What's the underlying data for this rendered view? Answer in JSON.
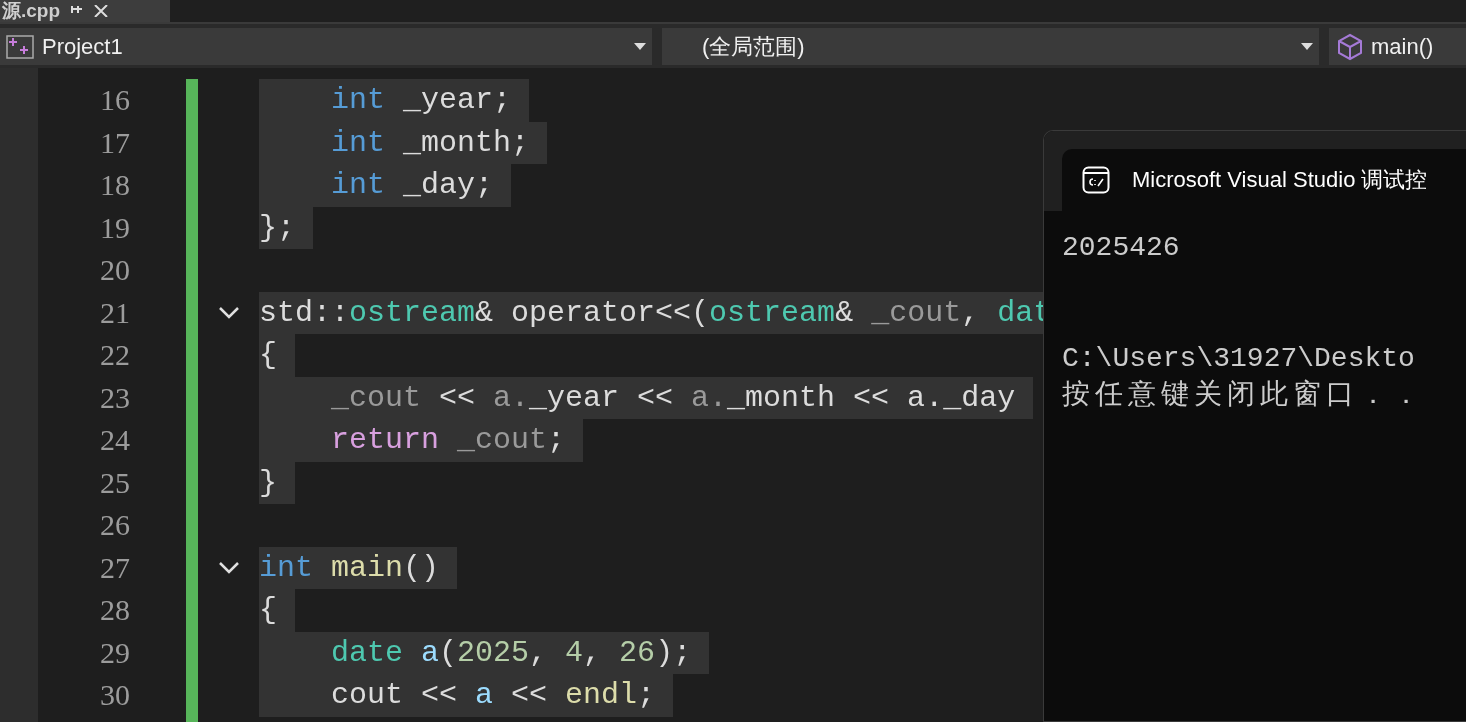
{
  "document_tab": {
    "title": "源.cpp"
  },
  "navigation_bar": {
    "project": "Project1",
    "scope": "(全局范围)",
    "member": "main()"
  },
  "editor": {
    "lines": [
      {
        "number": "16",
        "indented": true,
        "tokens": [
          {
            "kind": "keyword",
            "text": "int"
          },
          {
            "kind": "plain",
            "text": " _year;"
          }
        ]
      },
      {
        "number": "17",
        "indented": true,
        "tokens": [
          {
            "kind": "keyword",
            "text": "int"
          },
          {
            "kind": "plain",
            "text": " _month;"
          }
        ]
      },
      {
        "number": "18",
        "indented": true,
        "tokens": [
          {
            "kind": "keyword",
            "text": "int"
          },
          {
            "kind": "plain",
            "text": " _day;"
          }
        ]
      },
      {
        "number": "19",
        "indented": false,
        "tokens": [
          {
            "kind": "plain",
            "text": "};"
          }
        ]
      },
      {
        "number": "20",
        "indented": false
      },
      {
        "number": "21",
        "indented": false,
        "kind": "fold",
        "tokens": [
          {
            "kind": "plain",
            "text": "std::"
          },
          {
            "kind": "type",
            "text": "ostream"
          },
          {
            "kind": "plain",
            "text": "& operator<<("
          },
          {
            "kind": "type",
            "text": "ostream"
          },
          {
            "kind": "plain",
            "text": "& "
          },
          {
            "kind": "param",
            "text": "_cout"
          },
          {
            "kind": "plain",
            "text": ", "
          },
          {
            "kind": "type",
            "text": "dat"
          }
        ]
      },
      {
        "number": "22",
        "indented": false,
        "tokens": [
          {
            "kind": "plain",
            "text": "{"
          }
        ]
      },
      {
        "number": "23",
        "indented": true,
        "tokens": [
          {
            "kind": "param",
            "text": "_cout"
          },
          {
            "kind": "plain",
            "text": " << "
          },
          {
            "kind": "param",
            "text": "a."
          },
          {
            "kind": "plain",
            "text": "_year << "
          },
          {
            "kind": "param",
            "text": "a."
          },
          {
            "kind": "plain",
            "text": "_month << a._day"
          }
        ]
      },
      {
        "number": "24",
        "indented": true,
        "tokens": [
          {
            "kind": "control",
            "text": "return"
          },
          {
            "kind": "param",
            "text": " _cout"
          },
          {
            "kind": "plain",
            "text": ";"
          }
        ]
      },
      {
        "number": "25",
        "indented": false,
        "tokens": [
          {
            "kind": "plain",
            "text": "}"
          }
        ]
      },
      {
        "number": "26",
        "indented": false
      },
      {
        "number": "27",
        "indented": false,
        "kind": "fold",
        "tokens": [
          {
            "kind": "keyword",
            "text": "int"
          },
          {
            "kind": "function",
            "text": " main"
          },
          {
            "kind": "plain",
            "text": "()"
          }
        ]
      },
      {
        "number": "28",
        "indented": false,
        "tokens": [
          {
            "kind": "plain",
            "text": "{"
          }
        ]
      },
      {
        "number": "29",
        "indented": true,
        "tokens": [
          {
            "kind": "type",
            "text": "date"
          },
          {
            "kind": "variable",
            "text": " a"
          },
          {
            "kind": "plain",
            "text": "("
          },
          {
            "kind": "number",
            "text": "2025"
          },
          {
            "kind": "plain",
            "text": ", "
          },
          {
            "kind": "number",
            "text": "4"
          },
          {
            "kind": "plain",
            "text": ", "
          },
          {
            "kind": "number",
            "text": "26"
          },
          {
            "kind": "plain",
            "text": ");"
          }
        ]
      },
      {
        "number": "30",
        "indented": true,
        "tokens": [
          {
            "kind": "plain",
            "text": "cout << "
          },
          {
            "kind": "variable",
            "text": "a"
          },
          {
            "kind": "plain",
            "text": " << "
          },
          {
            "kind": "function",
            "text": "endl"
          },
          {
            "kind": "plain",
            "text": ";"
          }
        ]
      }
    ]
  },
  "console": {
    "title": "Microsoft Visual Studio 调试控",
    "output": [
      [
        "2025426"
      ],
      [
        "C:\\Users\\31927\\Deskto",
        "按任意键关闭此窗口．．"
      ]
    ]
  }
}
